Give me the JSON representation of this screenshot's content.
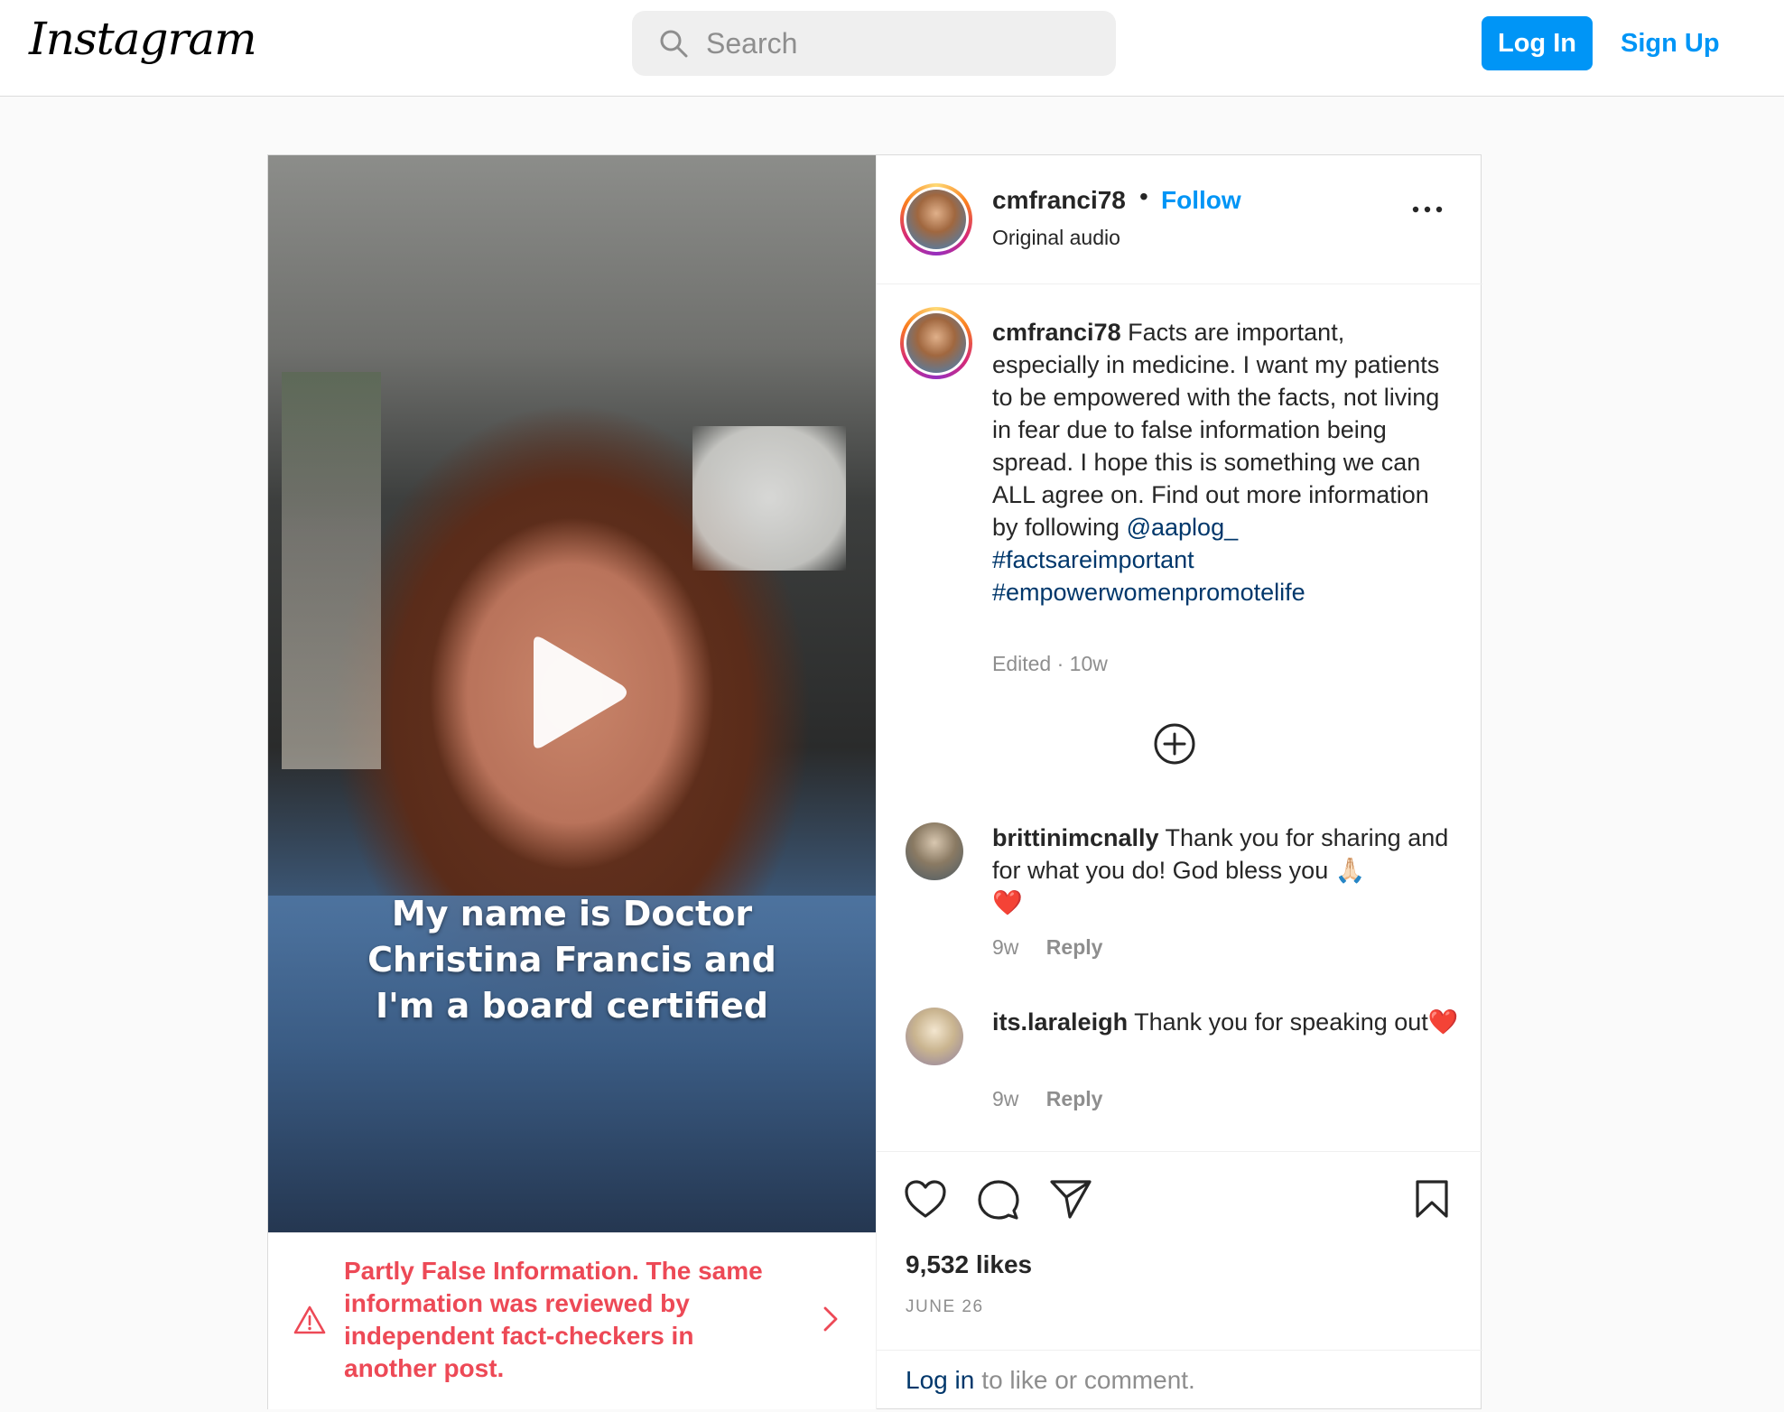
{
  "header": {
    "logo_text": "Instagram",
    "search_placeholder": "Search",
    "login_label": "Log In",
    "signup_label": "Sign Up"
  },
  "media": {
    "caption_lines": [
      "My name is Doctor",
      "Christina Francis and",
      "I'm a board certified"
    ]
  },
  "fact_check": {
    "text": "Partly False Information. The same information was reviewed by independent fact-checkers in another post."
  },
  "post_header": {
    "username": "cmfranci78",
    "separator": "•",
    "follow_label": "Follow",
    "audio": "Original audio"
  },
  "caption": {
    "username": "cmfranci78",
    "text": "Facts are important, especially in medicine. I want my patients to be empowered with the facts, not living in fear due to false information being spread. I hope this is something we can ALL agree on. Find out more information by following",
    "mention": "@aaplog_",
    "hashtags": [
      "#factsareimportant",
      "#empowerwomenpromotelife"
    ],
    "meta": "Edited · 10w"
  },
  "comments": [
    {
      "username": "brittinimcnally",
      "text": "Thank you for sharing and for what you do! God bless you 🙏🏻",
      "emoji": "❤️",
      "time": "9w",
      "reply": "Reply"
    },
    {
      "username": "its.laraleigh",
      "text": "Thank you for speaking out",
      "emoji": "❤️",
      "time": "9w",
      "reply": "Reply"
    }
  ],
  "stats": {
    "likes": "9,532 likes",
    "date": "JUNE 26"
  },
  "footer": {
    "login_link": "Log in",
    "login_rest": "to like or comment."
  },
  "colors": {
    "accent": "#0095f6",
    "warning": "#ed4956",
    "link": "#00376b",
    "muted": "#8e8e8e"
  },
  "icons": [
    "search-icon",
    "play-icon",
    "warning-icon",
    "chevron-right-icon",
    "more-icon",
    "add-circle-icon",
    "heart-icon",
    "comment-icon",
    "share-icon",
    "bookmark-icon"
  ]
}
